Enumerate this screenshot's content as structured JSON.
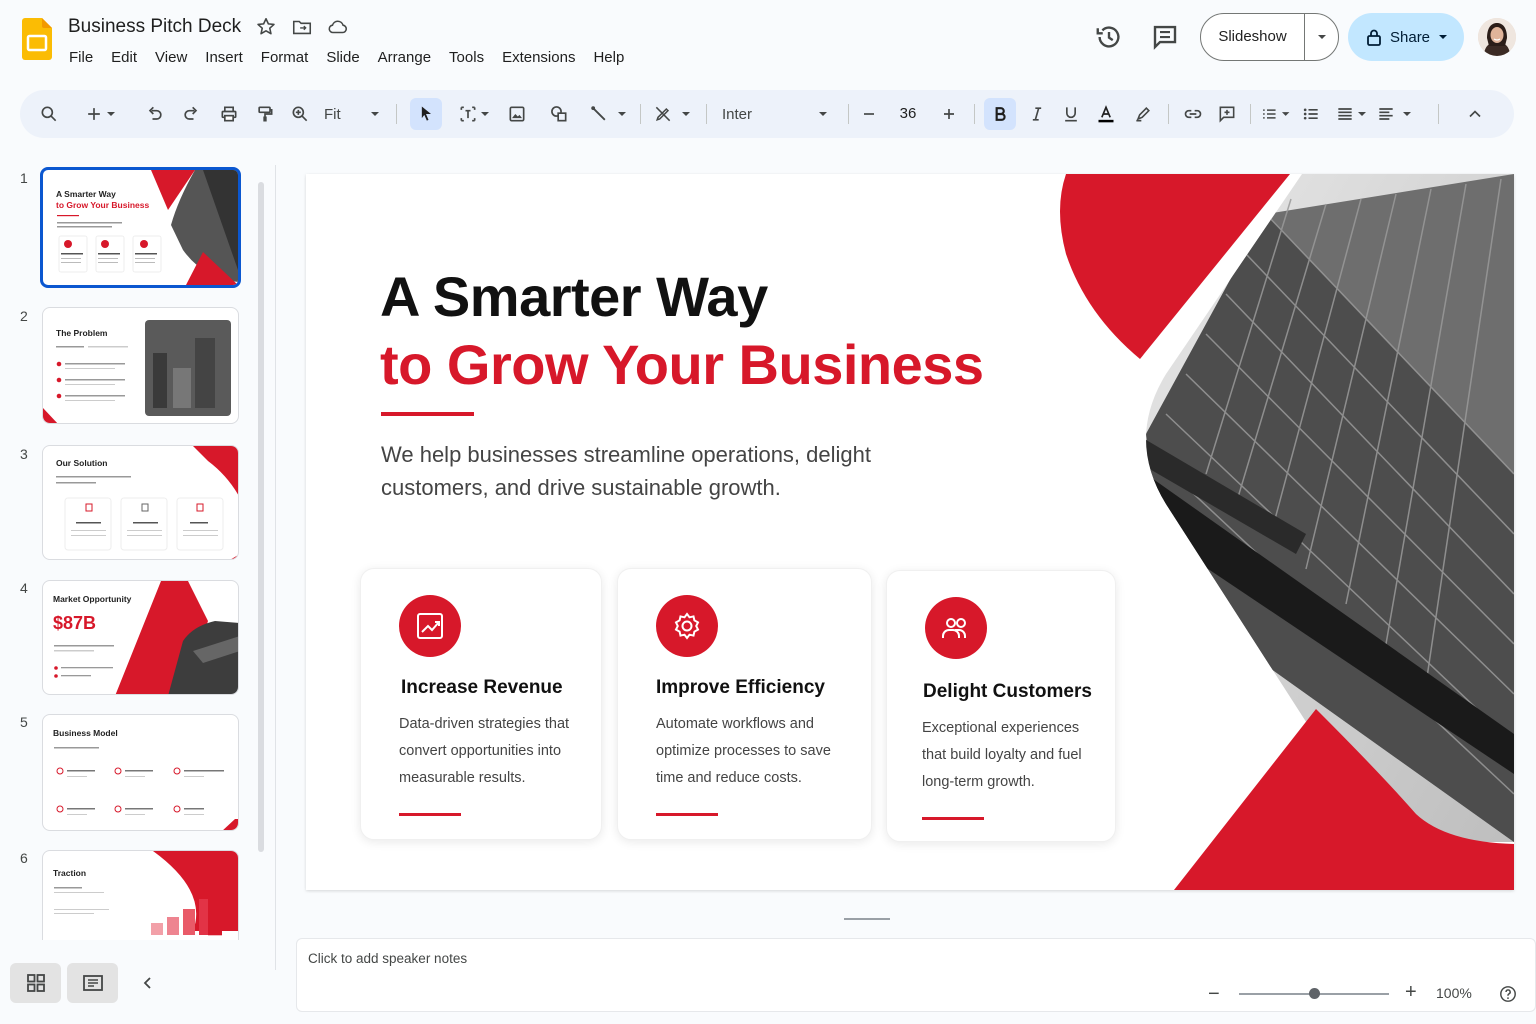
{
  "app": {
    "doc_title": "Business Pitch Deck",
    "menu": [
      "File",
      "Edit",
      "View",
      "Insert",
      "Format",
      "Slide",
      "Arrange",
      "Tools",
      "Extensions",
      "Help"
    ],
    "slideshow_label": "Slideshow",
    "share_label": "Share",
    "accent_color": "#d7182a",
    "brand_color": "#fbbc04"
  },
  "toolbar": {
    "zoom_mode": "Fit",
    "font_name": "Inter",
    "font_size": "36",
    "icons": [
      "search-icon",
      "add-icon",
      "undo-icon",
      "redo-icon",
      "print-icon",
      "paint-format-icon",
      "zoom-icon",
      "select-icon",
      "textbox-icon",
      "image-icon",
      "shape-icon",
      "line-icon",
      "pen-icon",
      "bold-icon",
      "italic-icon",
      "underline-icon",
      "text-color-icon",
      "highlight-icon",
      "link-icon",
      "comment-add-icon",
      "bullets-icon",
      "numbered-list-icon",
      "align-icon",
      "line-spacing-icon",
      "collapse-icon"
    ]
  },
  "filmstrip": {
    "slides": [
      {
        "num": "1",
        "title": "A Smarter Way",
        "title2": "to Grow Your Business"
      },
      {
        "num": "2",
        "title": "The Problem"
      },
      {
        "num": "3",
        "title": "Our Solution"
      },
      {
        "num": "4",
        "title": "Market Opportunity",
        "figure": "$87B"
      },
      {
        "num": "5",
        "title": "Business Model"
      },
      {
        "num": "6",
        "title": "Traction"
      }
    ]
  },
  "slide": {
    "title_line1": "A Smarter Way",
    "title_line2": "to Grow Your Business",
    "subtitle": "We help businesses streamline operations, delight customers, and drive sustainable growth.",
    "cards": [
      {
        "title": "Increase Revenue",
        "text": "Data-driven strategies that convert opportunities into measurable results.",
        "icon": "chart-up-icon"
      },
      {
        "title": "Improve Efficiency",
        "text": "Automate workflows and optimize processes to save time and reduce costs.",
        "icon": "gear-icon"
      },
      {
        "title": "Delight Customers",
        "text": "Exceptional experiences that build loyalty and fuel long-term growth.",
        "icon": "people-icon"
      }
    ]
  },
  "notes": {
    "placeholder": "Click to add speaker notes"
  },
  "zoom": {
    "value": "100%",
    "level": 0.5
  }
}
